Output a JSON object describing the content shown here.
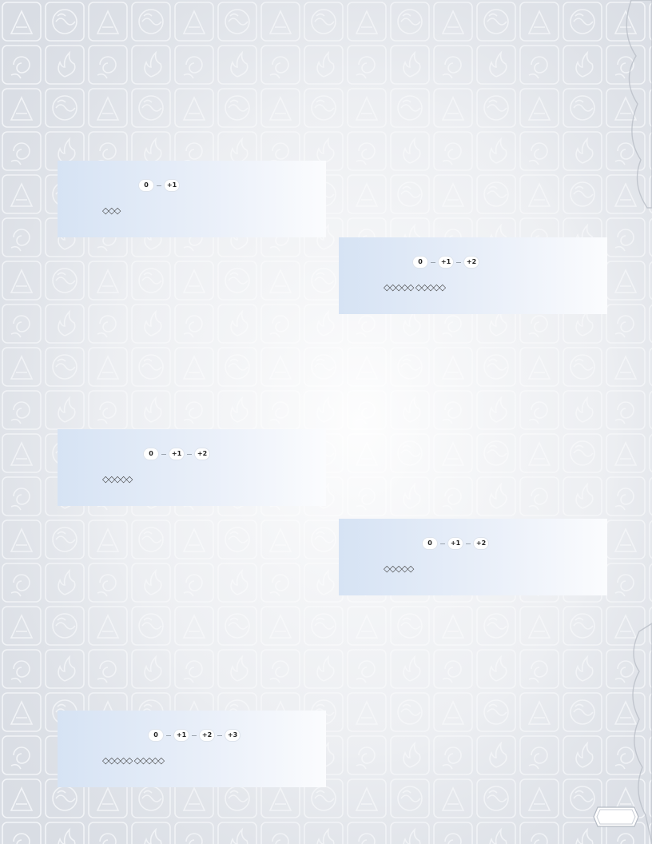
{
  "cards": [
    {
      "bubbles": [
        "0",
        "+1"
      ],
      "track": "◇◇◇"
    },
    {
      "bubbles": [
        "0",
        "+1",
        "+2"
      ],
      "track": "◇◇◇◇◇ ◇◇◇◇◇"
    },
    {
      "bubbles": [
        "0",
        "+1",
        "+2"
      ],
      "track": "◇◇◇◇◇"
    },
    {
      "bubbles": [
        "0",
        "+1",
        "+2"
      ],
      "track": "◇◇◇◇◇"
    },
    {
      "bubbles": [
        "0",
        "+1",
        "+2",
        "+3"
      ],
      "track": "◇◇◇◇◇ ◇◇◇◇◇"
    }
  ],
  "colors": {
    "card_start": "#d6e3f4",
    "card_end": "#fbfcfe",
    "pattern_stroke": "#c9ced8"
  },
  "icons": [
    "earth-kingdom-icon",
    "water-tribe-icon",
    "air-nomad-icon",
    "fire-nation-icon"
  ]
}
